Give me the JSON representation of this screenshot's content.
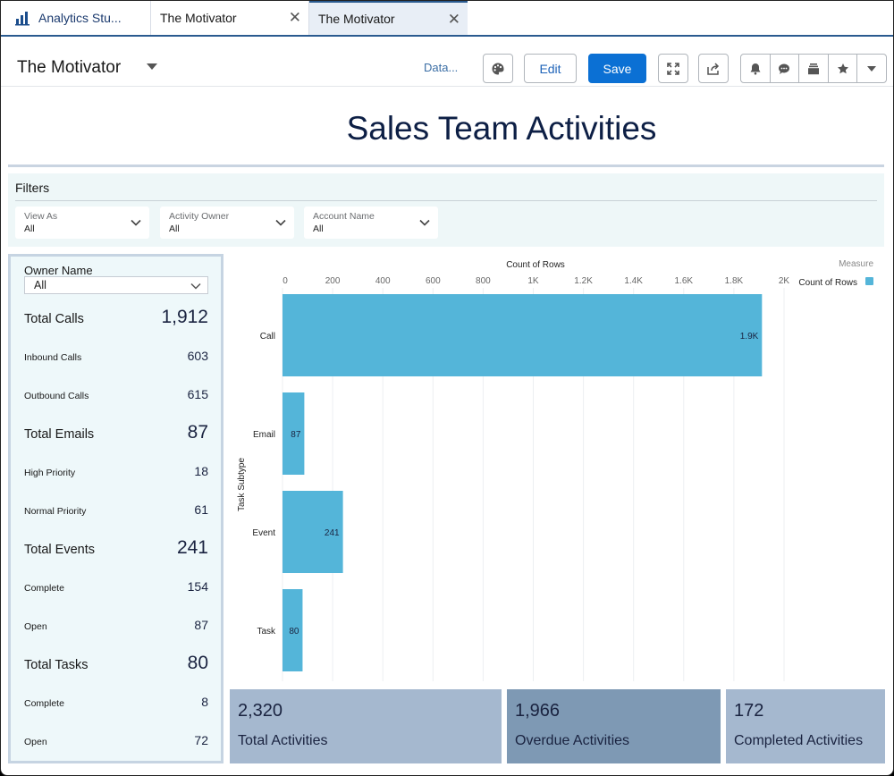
{
  "tabs": {
    "app": {
      "label": "Analytics Stu...",
      "icon": "analytics-bars-icon"
    },
    "items": [
      {
        "label": "The Motivator",
        "active": false,
        "close_icon": "close-icon"
      },
      {
        "label": "The Motivator",
        "active": true,
        "close_icon": "close-icon"
      }
    ]
  },
  "header": {
    "dashboard_name": "The Motivator",
    "data_link": "Data...",
    "edit_label": "Edit",
    "save_label": "Save",
    "icons": [
      "theme-palette-icon",
      "expand-icon",
      "share-icon",
      "bell-icon",
      "comment-icon",
      "collection-icon",
      "star-icon",
      "dropdown-caret-icon"
    ]
  },
  "title": "Sales Team Activities",
  "filters": {
    "label": "Filters",
    "items": [
      {
        "label": "View As",
        "value": "All"
      },
      {
        "label": "Activity Owner",
        "value": "All"
      },
      {
        "label": "Account Name",
        "value": "All"
      }
    ]
  },
  "owner_filter": {
    "label": "Owner Name",
    "value": "All"
  },
  "metrics": [
    {
      "label": "Total Calls",
      "value": "1,912",
      "kind": "big"
    },
    {
      "label": "Inbound Calls",
      "value": "603",
      "kind": "small"
    },
    {
      "label": "Outbound Calls",
      "value": "615",
      "kind": "small"
    },
    {
      "label": "Total Emails",
      "value": "87",
      "kind": "big"
    },
    {
      "label": "High Priority",
      "value": "18",
      "kind": "small"
    },
    {
      "label": "Normal Priority",
      "value": "61",
      "kind": "small"
    },
    {
      "label": "Total Events",
      "value": "241",
      "kind": "big"
    },
    {
      "label": "Complete",
      "value": "154",
      "kind": "small"
    },
    {
      "label": "Open",
      "value": "87",
      "kind": "small"
    },
    {
      "label": "Total Tasks",
      "value": "80",
      "kind": "big"
    },
    {
      "label": "Complete",
      "value": "8",
      "kind": "small"
    },
    {
      "label": "Open",
      "value": "72",
      "kind": "small"
    }
  ],
  "chart_data": {
    "type": "bar",
    "orientation": "horizontal",
    "title": "Count of Rows",
    "xlabel": "Count of Rows",
    "ylabel": "Task Subtype",
    "categories": [
      "Call",
      "Email",
      "Event",
      "Task"
    ],
    "values": [
      1912,
      87,
      241,
      80
    ],
    "data_labels": [
      "1.9K",
      "87",
      "241",
      "80"
    ],
    "xlim": [
      0,
      2000
    ],
    "xticks": [
      0,
      200,
      400,
      600,
      800,
      1000,
      1200,
      1400,
      1600,
      1800,
      2000
    ],
    "xtick_labels": [
      "0",
      "200",
      "400",
      "600",
      "800",
      "1K",
      "1.2K",
      "1.4K",
      "1.6K",
      "1.8K",
      "2K"
    ],
    "grid": true,
    "legend": {
      "title": "Measure",
      "entries": [
        "Count of Rows"
      ],
      "position": "top-right"
    },
    "color": "#54b5d9"
  },
  "kpis": [
    {
      "value": "2,320",
      "label": "Total Activities",
      "color": "#a5b8cf"
    },
    {
      "value": "1,966",
      "label": "Overdue Activities",
      "color": "#7e99b4"
    },
    {
      "value": "172",
      "label": "Completed Activities",
      "color": "#a5b8cf"
    }
  ]
}
